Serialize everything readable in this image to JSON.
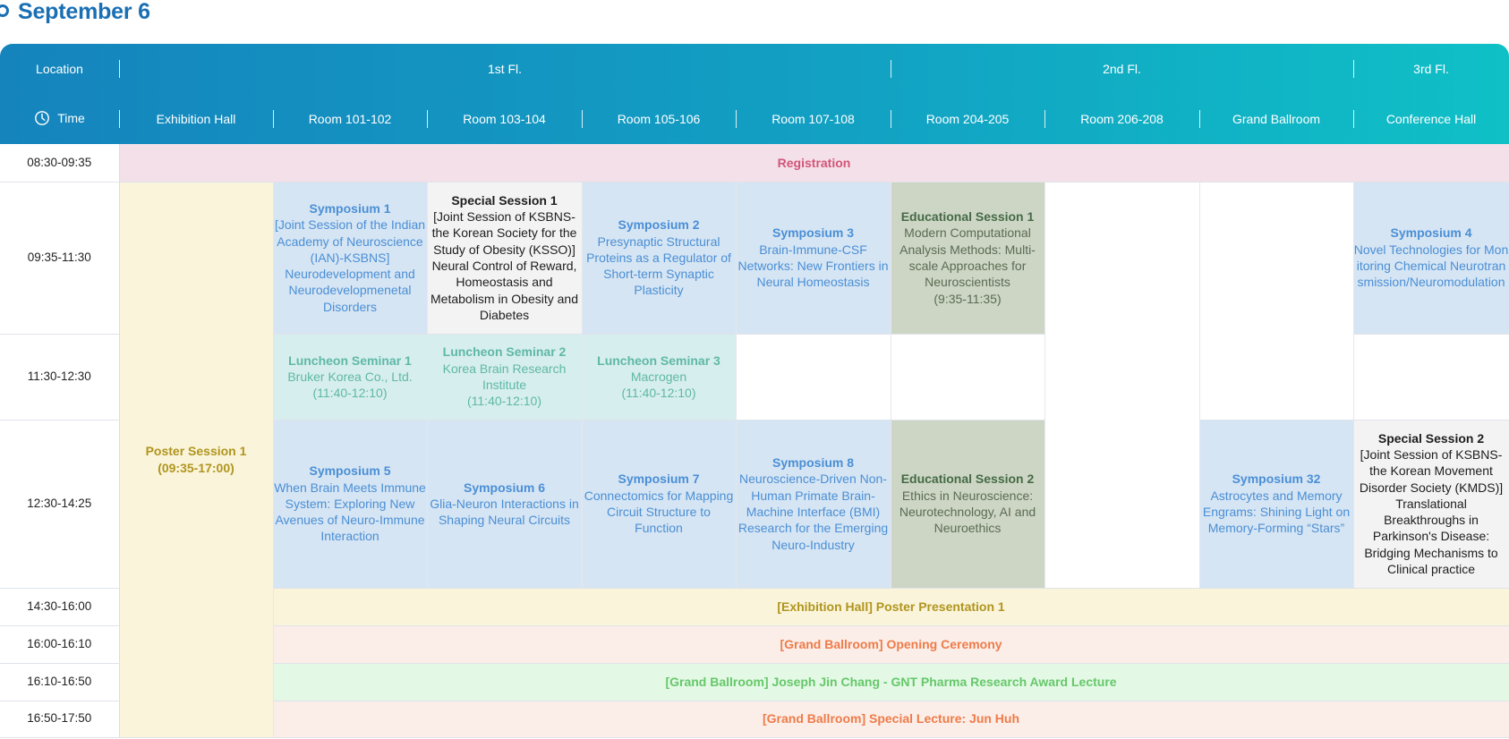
{
  "page": {
    "title": "September 6"
  },
  "header": {
    "location_label": "Location",
    "time_label": "Time",
    "floors": [
      "1st Fl.",
      "2nd Fl.",
      "3rd Fl."
    ],
    "rooms": [
      "Exhibition Hall",
      "Room 101-102",
      "Room 103-104",
      "Room 105-106",
      "Room 107-108",
      "Room 204-205",
      "Room 206-208",
      "Grand Ballroom",
      "Conference Hall"
    ]
  },
  "times": [
    "08:30-09:35",
    "09:35-11:30",
    "11:30-12:30",
    "12:30-14:25",
    "14:30-16:00",
    "16:00-16:10",
    "16:10-16:50",
    "16:50-17:50"
  ],
  "sessions": {
    "registration": "Registration",
    "poster_session": {
      "title": "Poster Session 1",
      "time": "(09:35-17:00)"
    },
    "sym1": {
      "title": "Symposium 1",
      "desc": "[Joint Session of the Indian Academy of Neuroscience (IAN)-KSBNS] Neurodevelopment and Neurodevelopmenetal Disorders"
    },
    "spec1": {
      "title": "Special Session 1",
      "desc": "[Joint Session of KSBNS-the Korean Society for the Study of Obesity (KSSO)] Neural Control of Reward, Homeostasis and Metabolism in Obesity and Diabetes"
    },
    "sym2": {
      "title": "Symposium 2",
      "desc": "Presynaptic Structural Proteins as a Regulator of Short-term Synaptic Plasticity"
    },
    "sym3": {
      "title": "Symposium 3",
      "desc": "Brain-Immune-CSF Networks: New Frontiers in Neural Homeostasis"
    },
    "edu1": {
      "title": "Educational Session 1",
      "desc": "Modern Computational Analysis Methods: Multi-scale Approaches for Neuroscientists",
      "time": "(9:35-11:35)"
    },
    "sym4": {
      "title": "Symposium 4",
      "desc": "Novel Technologies for Monitoring Chemical Neurotransmission/Neuromodulation"
    },
    "lunch1": {
      "title": "Luncheon Seminar 1",
      "desc": "Bruker Korea Co., Ltd.",
      "time": "(11:40-12:10)"
    },
    "lunch2": {
      "title": "Luncheon Seminar 2",
      "desc": "Korea Brain Research Institute",
      "time": "(11:40-12:10)"
    },
    "lunch3": {
      "title": "Luncheon Seminar 3",
      "desc": "Macrogen",
      "time": "(11:40-12:10)"
    },
    "sym5": {
      "title": "Symposium 5",
      "desc": "When Brain Meets Immune System: Exploring New Avenues of Neuro-Immune Interaction"
    },
    "sym6": {
      "title": "Symposium 6",
      "desc": "Glia-Neuron Interactions in Shaping Neural Circuits"
    },
    "sym7": {
      "title": "Symposium 7",
      "desc": "Connectomics for Mapping Circuit Structure to Function"
    },
    "sym8": {
      "title": "Symposium 8",
      "desc": "Neuroscience-Driven Non-Human Primate Brain-Machine Interface (BMI) Research for the Emerging Neuro-Industry"
    },
    "edu2": {
      "title": "Educational Session 2",
      "desc": "Ethics in Neuroscience: Neurotechnology, AI and Neuroethics"
    },
    "sym32": {
      "title": "Symposium 32",
      "desc": "Astrocytes and Memory Engrams: Shining Light on Memory-Forming “Stars”"
    },
    "spec2": {
      "title": "Special Session 2",
      "desc": "[Joint Session of KSBNS-the Korean Movement Disorder Society (KMDS)] Translational Breakthroughs in Parkinson's Disease: Bridging Mechanisms to Clinical practice"
    },
    "poster_presentation": "[Exhibition Hall] Poster Presentation 1",
    "opening": "[Grand Ballroom] Opening Ceremony",
    "award": "[Grand Ballroom] Joseph Jin Chang - GNT Pharma Research Award Lecture",
    "special_lecture": "[Grand Ballroom] Special Lecture: Jun Huh"
  },
  "colors": {
    "title": "#1a6fb3",
    "header_start": "#1584bd",
    "header_end": "#0fc0c6",
    "symposium": "#4a8fd6"
  },
  "icons": {
    "time": "clock-icon",
    "title_bullet": "circle-bullet-icon"
  }
}
